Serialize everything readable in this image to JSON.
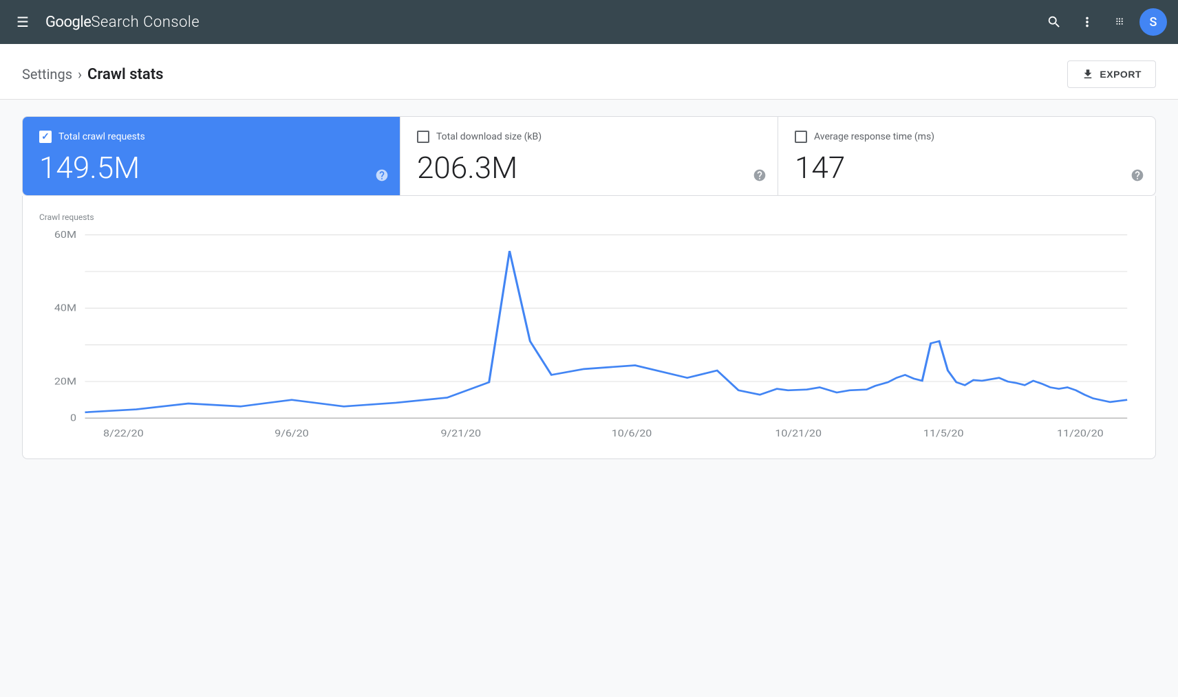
{
  "header": {
    "menu_icon": "☰",
    "logo_google": "Google ",
    "logo_title": "Search Console",
    "search_icon": "🔍",
    "more_icon": "⋮",
    "apps_icon": "⊞",
    "avatar_letter": "S"
  },
  "breadcrumb": {
    "parent": "Settings",
    "separator": "›",
    "current": "Crawl stats"
  },
  "export_button": {
    "label": "EXPORT",
    "icon": "↓"
  },
  "stats": [
    {
      "id": "total-crawl-requests",
      "label": "Total crawl requests",
      "value": "149.5M",
      "active": true,
      "checked": true
    },
    {
      "id": "total-download-size",
      "label": "Total download size (kB)",
      "value": "206.3M",
      "active": false,
      "checked": false
    },
    {
      "id": "average-response-time",
      "label": "Average response time (ms)",
      "value": "147",
      "active": false,
      "checked": false
    }
  ],
  "chart": {
    "y_label": "Crawl requests",
    "y_axis": [
      "60M",
      "40M",
      "20M",
      "0"
    ],
    "x_axis": [
      "8/22/20",
      "9/6/20",
      "9/21/20",
      "10/6/20",
      "10/21/20",
      "11/5/20",
      "11/20/20"
    ],
    "accent_color": "#4285f4",
    "grid_color": "#e0e0e0",
    "line_color": "#4285f4"
  }
}
